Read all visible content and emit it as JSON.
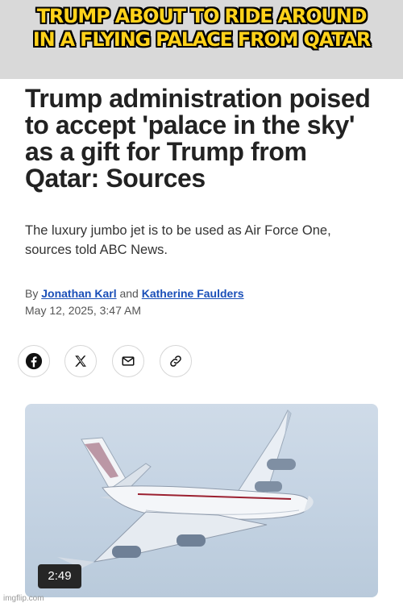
{
  "meme": {
    "caption_line1": "TRUMP ABOUT TO RIDE AROUND",
    "caption_line2": "IN A FLYING PALACE FROM QATAR"
  },
  "article": {
    "headline": "Trump administration poised to accept 'palace in the sky' as a gift for Trump from Qatar: Sources",
    "subhead": "The luxury jumbo jet is to be used as Air Force One, sources told ABC News.",
    "byline_prefix": "By",
    "author1": "Jonathan Karl",
    "byline_join": "and",
    "author2": "Katherine Faulders",
    "date": "May 12, 2025, 3:47 AM"
  },
  "share": {
    "icons": [
      "facebook-icon",
      "x-icon",
      "email-icon",
      "link-icon"
    ]
  },
  "video": {
    "duration": "2:49"
  },
  "watermark": "imgflip.com",
  "colors": {
    "caption": "#ffd21a",
    "author_link": "#1a4fb8",
    "headline": "#222222",
    "sky": "#c3d2e2"
  }
}
